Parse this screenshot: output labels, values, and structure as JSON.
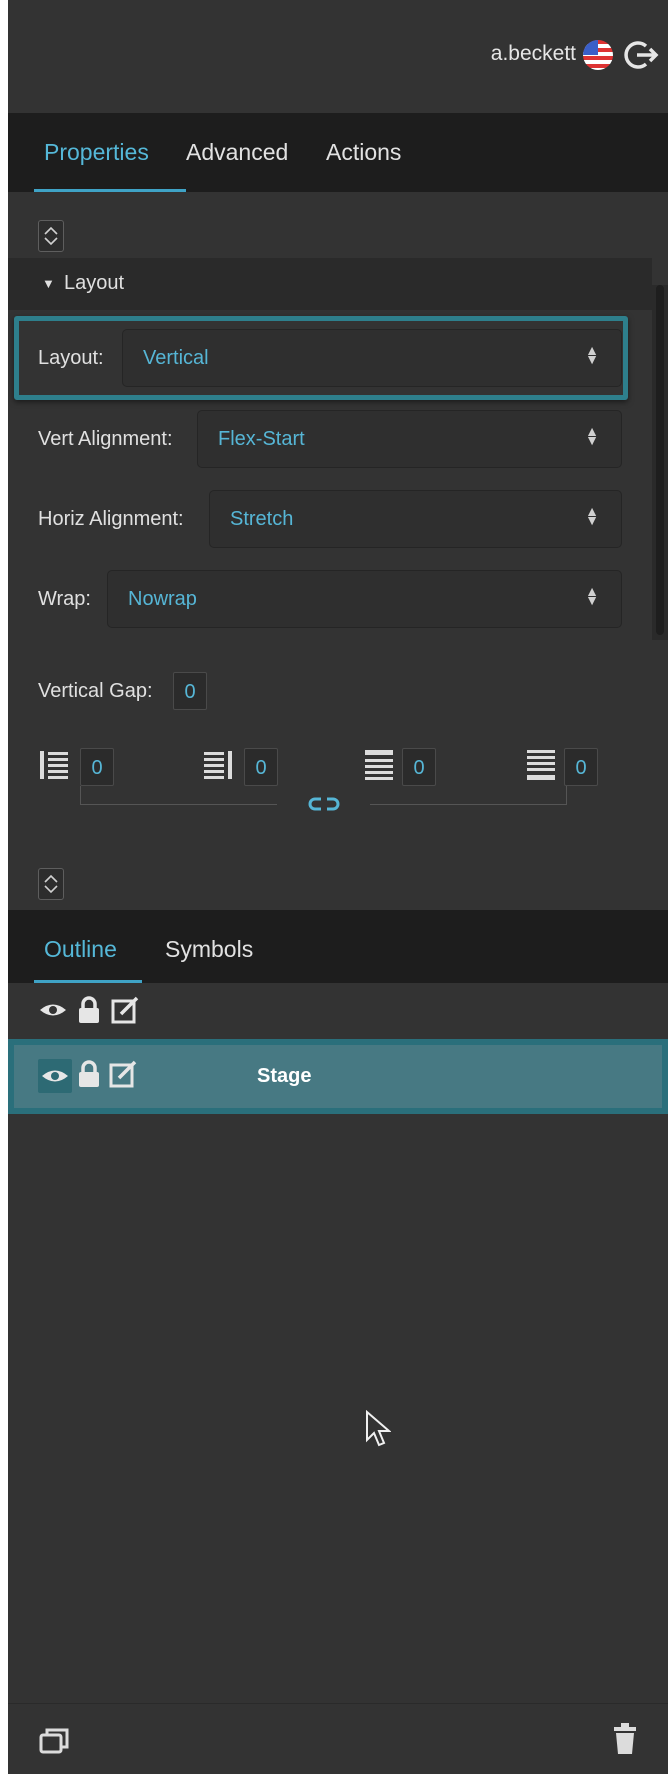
{
  "header": {
    "username": "a.beckett",
    "flag_icon": "us-flag-icon",
    "logout_icon": "logout-icon"
  },
  "tabs": [
    {
      "label": "Properties",
      "active": true
    },
    {
      "label": "Advanced",
      "active": false
    },
    {
      "label": "Actions",
      "active": false
    }
  ],
  "section": {
    "title": "Layout",
    "expanded": true
  },
  "fields": {
    "layout": {
      "label": "Layout:",
      "value": "Vertical"
    },
    "vert_alignment": {
      "label": "Vert Alignment:",
      "value": "Flex-Start"
    },
    "horiz_alignment": {
      "label": "Horiz Alignment:",
      "value": "Stretch"
    },
    "wrap": {
      "label": "Wrap:",
      "value": "Nowrap"
    },
    "vertical_gap": {
      "label": "Vertical Gap:",
      "value": "0"
    }
  },
  "padding": {
    "left": "0",
    "right": "0",
    "top": "0",
    "bottom": "0",
    "link_icon": "link-icon"
  },
  "bottom_tabs": [
    {
      "label": "Outline",
      "active": true
    },
    {
      "label": "Symbols",
      "active": false
    }
  ],
  "outline": {
    "rows": [
      {
        "name": "Stage",
        "selected": true
      }
    ]
  },
  "footer": {
    "duplicate_icon": "duplicate-icon",
    "delete_icon": "trash-icon"
  },
  "colors": {
    "accent": "#55b8d8",
    "selection": "#477983",
    "selection_border": "#2a6f7b",
    "panel": "#333333",
    "tabbar": "#1d1d1d"
  }
}
